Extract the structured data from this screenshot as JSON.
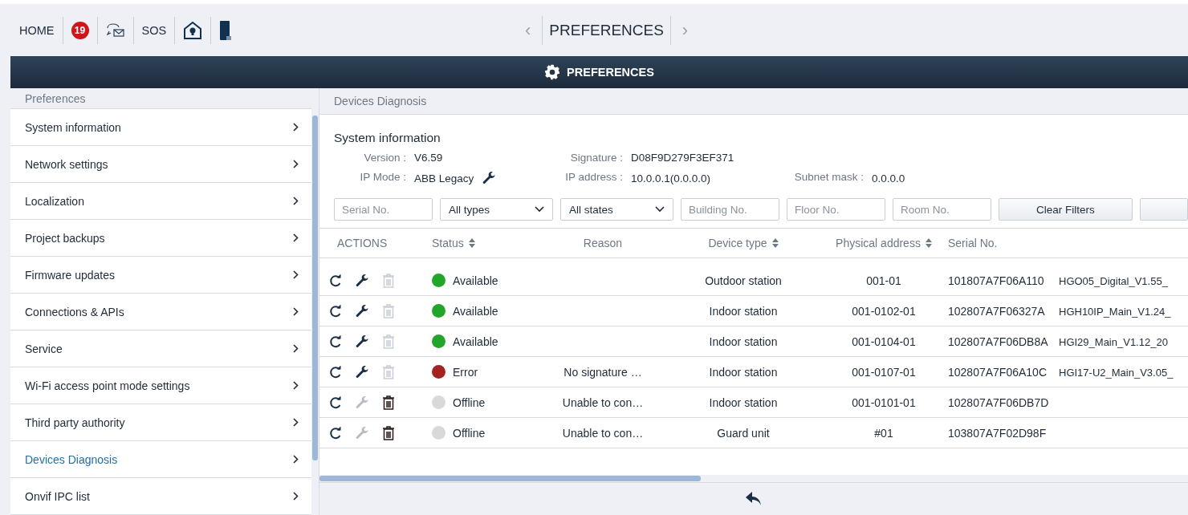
{
  "top_bar": {
    "home": "HOME",
    "badge": "19",
    "sos": "SOS",
    "prev": "‹",
    "title": "PREFERENCES",
    "next": "›"
  },
  "header": {
    "title": "PREFERENCES"
  },
  "sidebar": {
    "title": "Preferences",
    "items": [
      {
        "label": "System information",
        "selected": false
      },
      {
        "label": "Network settings",
        "selected": false
      },
      {
        "label": "Localization",
        "selected": false
      },
      {
        "label": "Project backups",
        "selected": false
      },
      {
        "label": "Firmware updates",
        "selected": false
      },
      {
        "label": "Connections & APIs",
        "selected": false
      },
      {
        "label": "Service",
        "selected": false
      },
      {
        "label": "Wi-Fi access point mode settings",
        "selected": false
      },
      {
        "label": "Third party authority",
        "selected": false
      },
      {
        "label": "Devices Diagnosis",
        "selected": true
      },
      {
        "label": "Onvif IPC list",
        "selected": false
      }
    ]
  },
  "content": {
    "title": "Devices Diagnosis",
    "section": "System information",
    "info": [
      [
        {
          "label": "Version :",
          "value": "V6.59",
          "wrench": false
        },
        {
          "label": "Signature :",
          "value": "D08F9D279F3EF371",
          "wrench": false
        }
      ],
      [
        {
          "label": "IP Mode :",
          "value": "ABB Legacy",
          "wrench": true
        },
        {
          "label": "IP address :",
          "value": "10.0.0.1(0.0.0.0)",
          "wrench": false
        },
        {
          "label": "Subnet mask :",
          "value": "0.0.0.0",
          "wrench": false
        }
      ]
    ],
    "filters": [
      {
        "kind": "input",
        "placeholder": "Serial No."
      },
      {
        "kind": "select",
        "value": "All types"
      },
      {
        "kind": "select",
        "value": "All states"
      },
      {
        "kind": "input",
        "placeholder": "Building No."
      },
      {
        "kind": "input",
        "placeholder": "Floor No."
      },
      {
        "kind": "input",
        "placeholder": "Room No."
      }
    ],
    "clear_button": "Clear Filters",
    "table": {
      "columns": [
        {
          "label": "ACTIONS",
          "sortable": false
        },
        {
          "label": "Status",
          "sortable": true
        },
        {
          "label": "Reason",
          "sortable": false
        },
        {
          "label": "Device type",
          "sortable": true
        },
        {
          "label": "Physical address",
          "sortable": true
        },
        {
          "label": "Serial No.",
          "sortable": false
        }
      ],
      "rows": [
        {
          "wrench_enabled": true,
          "delete_enabled": false,
          "color": "#22a52b",
          "status": "Available",
          "device_type": "Outdoor station",
          "physical_address": "001-01",
          "serial": "101807A7F06A110",
          "column_7": "HGO05_Digital_V1.55_"
        },
        {
          "wrench_enabled": true,
          "delete_enabled": false,
          "color": "#22a52b",
          "status": "Available",
          "device_type": "Indoor station",
          "physical_address": "001-0102-01",
          "serial": "102807A7F06327A",
          "column_7": "HGH10IP_Main_V1.24_"
        },
        {
          "wrench_enabled": true,
          "delete_enabled": false,
          "color": "#22a52b",
          "status": "Available",
          "device_type": "Indoor station",
          "physical_address": "001-0104-01",
          "serial": "102807A7F06DB8A",
          "column_7": "HGI29_Main_V1.12_20"
        },
        {
          "wrench_enabled": true,
          "delete_enabled": false,
          "color": "#a52222",
          "status": "Error",
          "reason": "No signature …",
          "device_type": "Indoor station",
          "physical_address": "001-0107-01",
          "serial": "102807A7F06A10C",
          "column_7": "HGI17-U2_Main_V3.05_"
        },
        {
          "wrench_enabled": false,
          "delete_enabled": true,
          "color": "#d9d9d9",
          "status": "Offline",
          "reason": "Unable to con…",
          "device_type": "Indoor station",
          "physical_address": "001-0101-01",
          "serial": "102807A7F06DB7D"
        },
        {
          "wrench_enabled": false,
          "delete_enabled": true,
          "color": "#d9d9d9",
          "status": "Offline",
          "reason": "Unable to con…",
          "device_type": "Guard unit",
          "physical_address": "#01",
          "serial": "103807A7F02D98F"
        }
      ]
    }
  }
}
